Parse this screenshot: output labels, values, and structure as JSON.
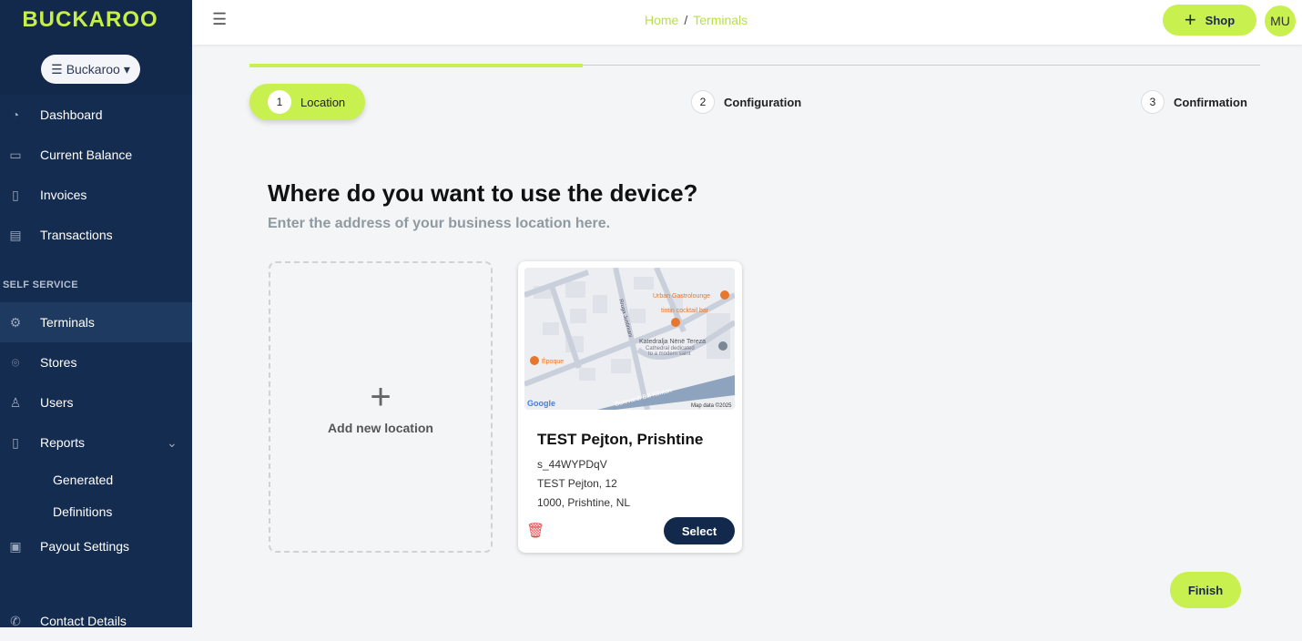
{
  "brand": {
    "logo": "BUCKAROO",
    "accent": "#c8f04e",
    "sidebar_bg": "#13294b"
  },
  "org_switcher": {
    "label": "Buckaroo",
    "icon": "list-icon"
  },
  "sidebar": {
    "items": [
      {
        "label": "Dashboard",
        "icon": "gauge-icon"
      },
      {
        "label": "Current Balance",
        "icon": "card-icon"
      },
      {
        "label": "Invoices",
        "icon": "file-icon"
      },
      {
        "label": "Transactions",
        "icon": "table-icon"
      },
      {
        "label": "Terminals",
        "icon": "gear-icon"
      },
      {
        "label": "Stores",
        "icon": "map-pin-icon"
      },
      {
        "label": "Users",
        "icon": "user-icon"
      },
      {
        "label": "Reports",
        "icon": "report-icon"
      },
      {
        "label": "Payout Settings",
        "icon": "money-icon"
      },
      {
        "label": "Contact Details",
        "icon": "phone-icon"
      }
    ],
    "section": "SELF SERVICE",
    "reports_sub": [
      "Generated",
      "Definitions"
    ],
    "active": "Terminals"
  },
  "header": {
    "breadcrumb": [
      "Home",
      "Terminals"
    ],
    "shop_label": "Shop",
    "avatar": "MU"
  },
  "stepper": {
    "progress_percent": 33,
    "steps": [
      {
        "num": "1",
        "label": "Location"
      },
      {
        "num": "2",
        "label": "Configuration"
      },
      {
        "num": "3",
        "label": "Confirmation"
      }
    ]
  },
  "main": {
    "title": "Where do you want to use the device?",
    "subtitle": "Enter the address of your business location here.",
    "add_label": "Add new location",
    "location": {
      "name": "TEST Pejton, Prishtine",
      "id": "s_44WYPDqV",
      "street": "TEST Pejton, 12",
      "city": "1000, Prishtine, NL",
      "select_label": "Select",
      "map": {
        "labels": [
          "Urban Gastrolounge",
          "tintin cocktail bar",
          "Katedralja Nënë Tereza",
          "Cathedral dedicated",
          "to a modern saint",
          "Époque",
          "Rruga Justiniani",
          "Bulevardi Bill Klinton",
          "Google",
          "Map data ©2025"
        ]
      }
    },
    "finish_label": "Finish"
  }
}
